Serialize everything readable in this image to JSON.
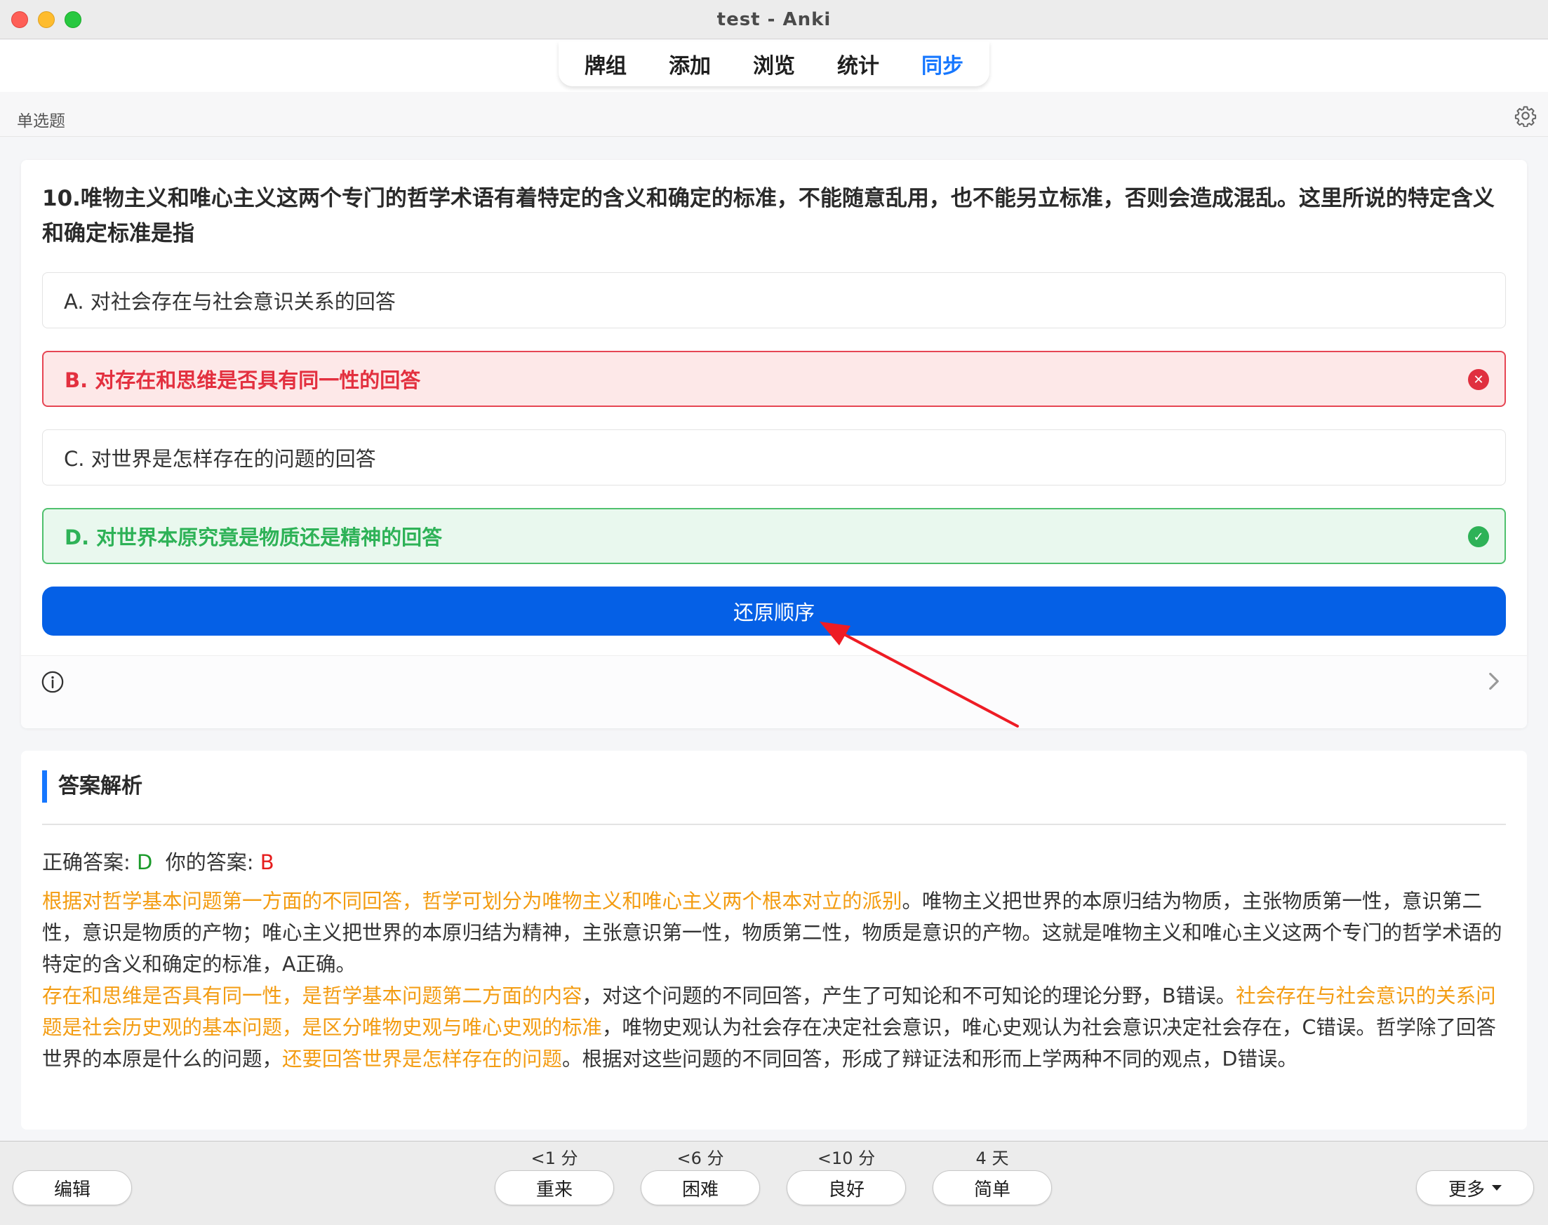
{
  "window": {
    "title": "test - Anki"
  },
  "nav": {
    "decks": "牌组",
    "add": "添加",
    "browse": "浏览",
    "stats": "统计",
    "sync": "同步"
  },
  "notetype": {
    "label": "单选题"
  },
  "question": {
    "text": "10.唯物主义和唯心主义这两个专门的哲学术语有着特定的含义和确定的标准，不能随意乱用，也不能另立标准，否则会造成混乱。这里所说的特定含义和确定标准是指",
    "options": [
      {
        "label": "A. 对社会存在与社会意识关系的回答",
        "state": "neutral"
      },
      {
        "label": "B. 对存在和思维是否具有同一性的回答",
        "state": "wrong"
      },
      {
        "label": "C. 对世界是怎样存在的问题的回答",
        "state": "neutral"
      },
      {
        "label": "D. 对世界本原究竟是物质还是精神的回答",
        "state": "correct"
      }
    ],
    "restore_button": "还原顺序"
  },
  "answer": {
    "heading": "答案解析",
    "correct_label": "正确答案: ",
    "correct_value": "D",
    "yours_label": "你的答案: ",
    "yours_value": "B",
    "p1_hl": "根据对哲学基本问题第一方面的不同回答，哲学可划分为唯物主义和唯心主义两个根本对立的派别",
    "p1_rest": "。唯物主义把世界的本原归结为物质，主张物质第一性，意识第二性，意识是物质的产物；唯心主义把世界的本原归结为精神，主张意识第一性，物质第二性，物质是意识的产物。这就是唯物主义和唯心主义这两个专门的哲学术语的特定的含义和确定的标准，A正确。",
    "p2_hl1": "存在和思维是否具有同一性，是哲学基本问题第二方面的内容",
    "p2_mid1": "，对这个问题的不同回答，产生了可知论和不可知论的理论分野，B错误。",
    "p2_hl2": "社会存在与社会意识的关系问题是社会历史观的基本问题，是区分唯物史观与唯心史观的标准",
    "p2_mid2": "，唯物史观认为社会存在决定社会意识，唯心史观认为社会意识决定社会存在，C错误。哲学除了回答世界的本原是什么的问题，",
    "p2_hl3": "还要回答世界是怎样存在的问题",
    "p2_end": "。根据对这些问题的不同回答，形成了辩证法和形而上学两种不同的观点，D错误。"
  },
  "bottom": {
    "edit": "编辑",
    "more": "更多",
    "again_interval": "<1 分",
    "again": "重来",
    "hard_interval": "<6 分",
    "hard": "困难",
    "good_interval": "<10 分",
    "good": "良好",
    "easy_interval": "4 天",
    "easy": "简单"
  },
  "colors": {
    "accent": "#1677ff",
    "primary_button": "#0560e6",
    "wrong": "#e3303f",
    "correct": "#2eb257",
    "highlight": "#f39c12"
  },
  "icons": {
    "settings": "gear-icon",
    "info": "info-icon",
    "next": "chevron-right-icon",
    "wrong_mark": "x-circle-icon",
    "correct_mark": "check-circle-icon",
    "dropdown": "caret-down-icon"
  }
}
